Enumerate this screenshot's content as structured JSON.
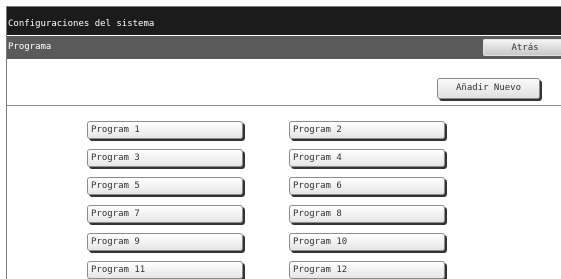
{
  "header": {
    "title": "Configuraciones del sistema"
  },
  "subheader": {
    "title": "Programa",
    "back_label": "Atrás"
  },
  "actions": {
    "add_new_label": "Añadir Nuevo"
  },
  "programs": [
    "Program 1",
    "Program 2",
    "Program 3",
    "Program 4",
    "Program 5",
    "Program 6",
    "Program 7",
    "Program 8",
    "Program 9",
    "Program 10",
    "Program 11",
    "Program 12"
  ]
}
